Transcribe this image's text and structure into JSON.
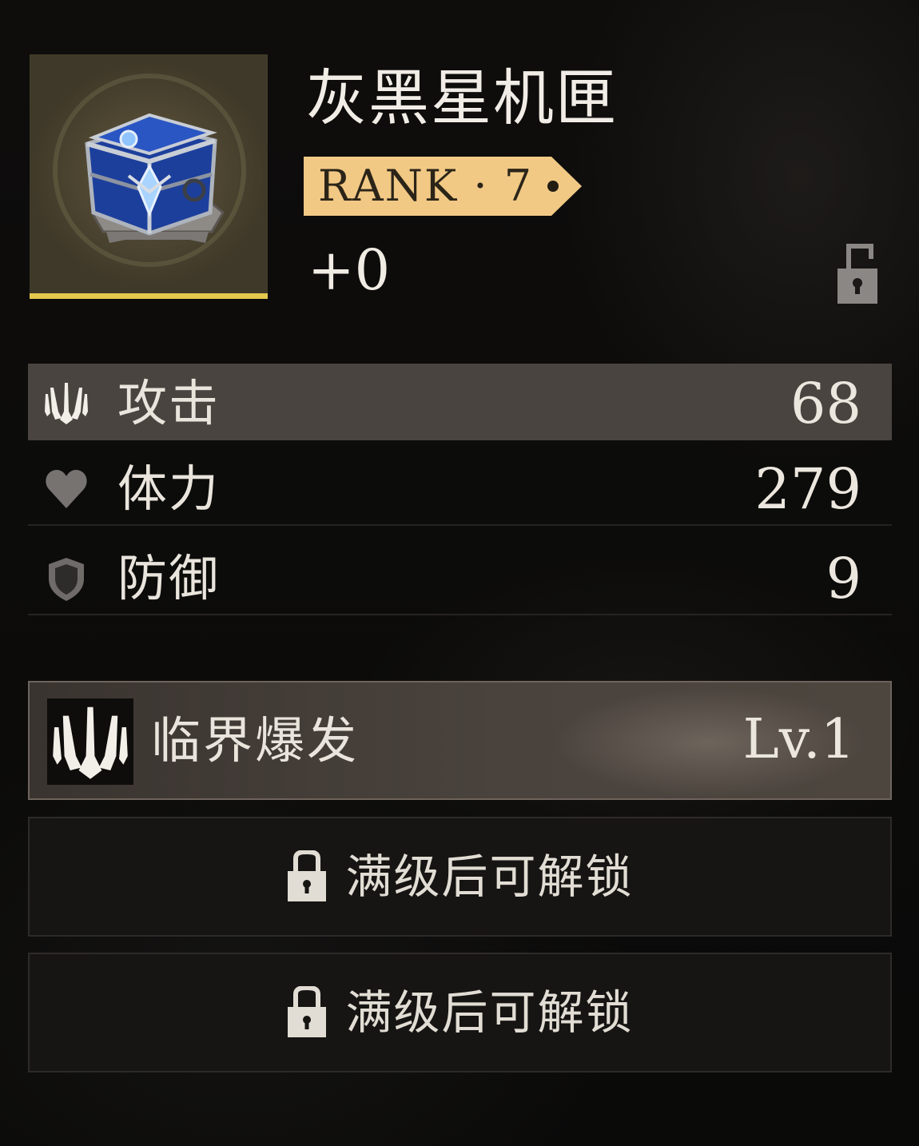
{
  "item": {
    "name": "灰黑星机匣",
    "rank_label": "RANK · 7",
    "enhance_level": "+0",
    "lock_icon": "lock-open-icon",
    "portrait_icon": "chest-icon",
    "rarity_color": "#e3c84d"
  },
  "stats": [
    {
      "icon": "trident-icon",
      "label": "攻击",
      "value": "68",
      "highlighted": true
    },
    {
      "icon": "heart-icon",
      "label": "体力",
      "value": "279",
      "highlighted": false
    },
    {
      "icon": "shield-icon",
      "label": "防御",
      "value": "9",
      "highlighted": false
    }
  ],
  "skill": {
    "icon": "trident-icon",
    "name": "临界爆发",
    "level": "Lv.1"
  },
  "locked_slots": [
    {
      "icon": "lock-icon",
      "label": "满级后可解锁"
    },
    {
      "icon": "lock-icon",
      "label": "满级后可解锁"
    }
  ]
}
